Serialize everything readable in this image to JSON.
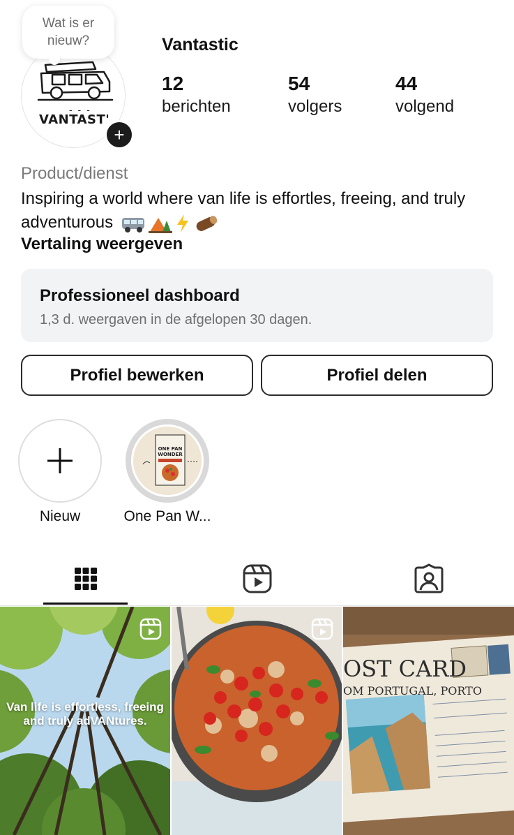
{
  "profile": {
    "username": "Vantastic",
    "note": "Wat is er nieuw?",
    "avatar_text": "VANTAST'",
    "stats": [
      {
        "value": "12",
        "label": "berichten"
      },
      {
        "value": "54",
        "label": "volgers"
      },
      {
        "value": "44",
        "label": "volgend"
      }
    ],
    "category": "Product/dienst",
    "bio": "Inspiring a world where van life is effortles, freeing, and truly adventurous",
    "translate_label": "Vertaling weergeven"
  },
  "dashboard": {
    "title": "Professioneel dashboard",
    "subtitle": "1,3 d. weergaven in de afgelopen 30 dagen."
  },
  "buttons": {
    "edit": "Profiel bewerken",
    "share": "Profiel delen"
  },
  "highlights": [
    {
      "label": "Nieuw"
    },
    {
      "label": "One Pan W..."
    }
  ],
  "highlight_cover": {
    "line1": "ONE PAN",
    "line2": "WONDER"
  },
  "tabs": [
    "grid-icon",
    "reels-icon",
    "tagged-icon"
  ],
  "posts": [
    {
      "overlay_text": "Van life is effortless, freeing and truly adVANtures."
    },
    {
      "overlay_text": ""
    },
    {
      "overlay_text": "OST CARD",
      "overlay_sub": "OM PORTUGAL, PORTO"
    }
  ]
}
